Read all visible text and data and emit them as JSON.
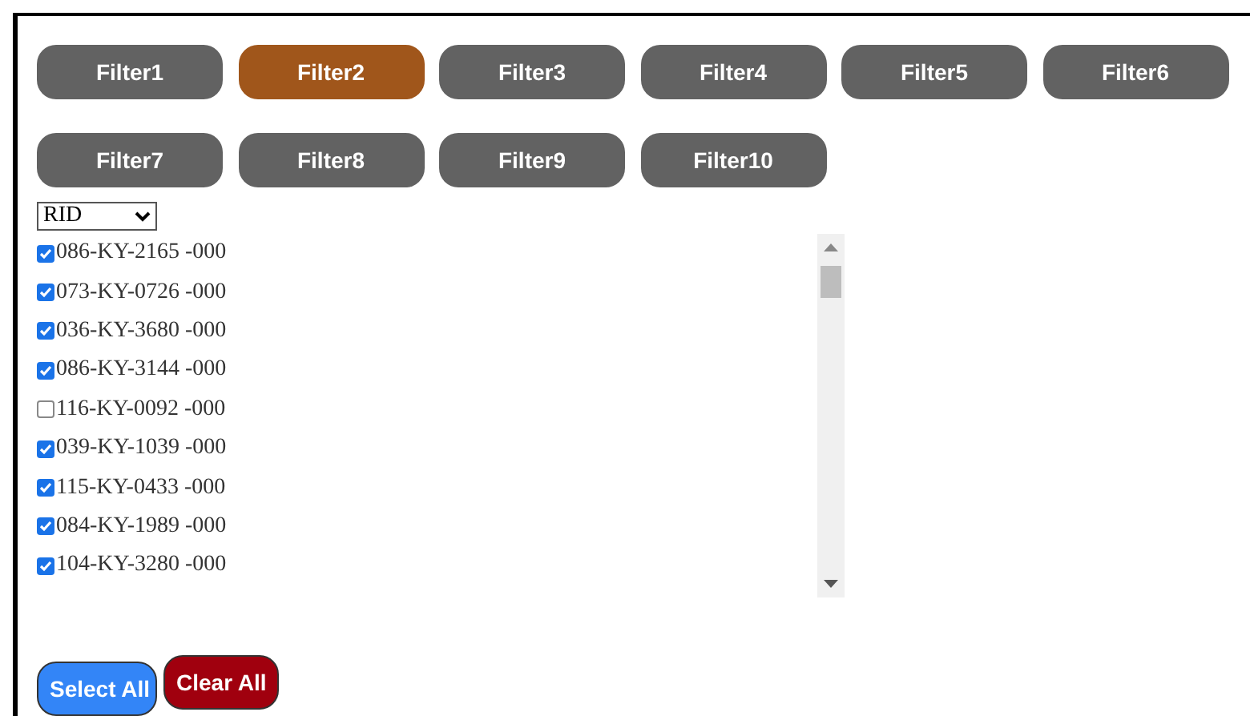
{
  "filters": [
    {
      "label": "Filter1",
      "selected": false
    },
    {
      "label": "Filter2",
      "selected": true
    },
    {
      "label": "Filter3",
      "selected": false
    },
    {
      "label": "Filter4",
      "selected": false
    },
    {
      "label": "Filter5",
      "selected": false
    },
    {
      "label": "Filter6",
      "selected": false
    },
    {
      "label": "Filter7",
      "selected": false
    },
    {
      "label": "Filter8",
      "selected": false
    },
    {
      "label": "Filter9",
      "selected": false
    },
    {
      "label": "Filter10",
      "selected": false
    }
  ],
  "dropdown": {
    "value": "RID"
  },
  "items": [
    {
      "label": "086-KY-2165 -000",
      "checked": true
    },
    {
      "label": "073-KY-0726 -000",
      "checked": true
    },
    {
      "label": "036-KY-3680 -000",
      "checked": true
    },
    {
      "label": "086-KY-3144 -000",
      "checked": true
    },
    {
      "label": "116-KY-0092 -000",
      "checked": false
    },
    {
      "label": "039-KY-1039 -000",
      "checked": true
    },
    {
      "label": "115-KY-0433 -000",
      "checked": true
    },
    {
      "label": "084-KY-1989 -000",
      "checked": true
    },
    {
      "label": "104-KY-3280 -000",
      "checked": true
    }
  ],
  "buttons": [
    {
      "label": "Select All",
      "kind": "select"
    },
    {
      "label": "Clear All",
      "kind": "clear"
    }
  ]
}
